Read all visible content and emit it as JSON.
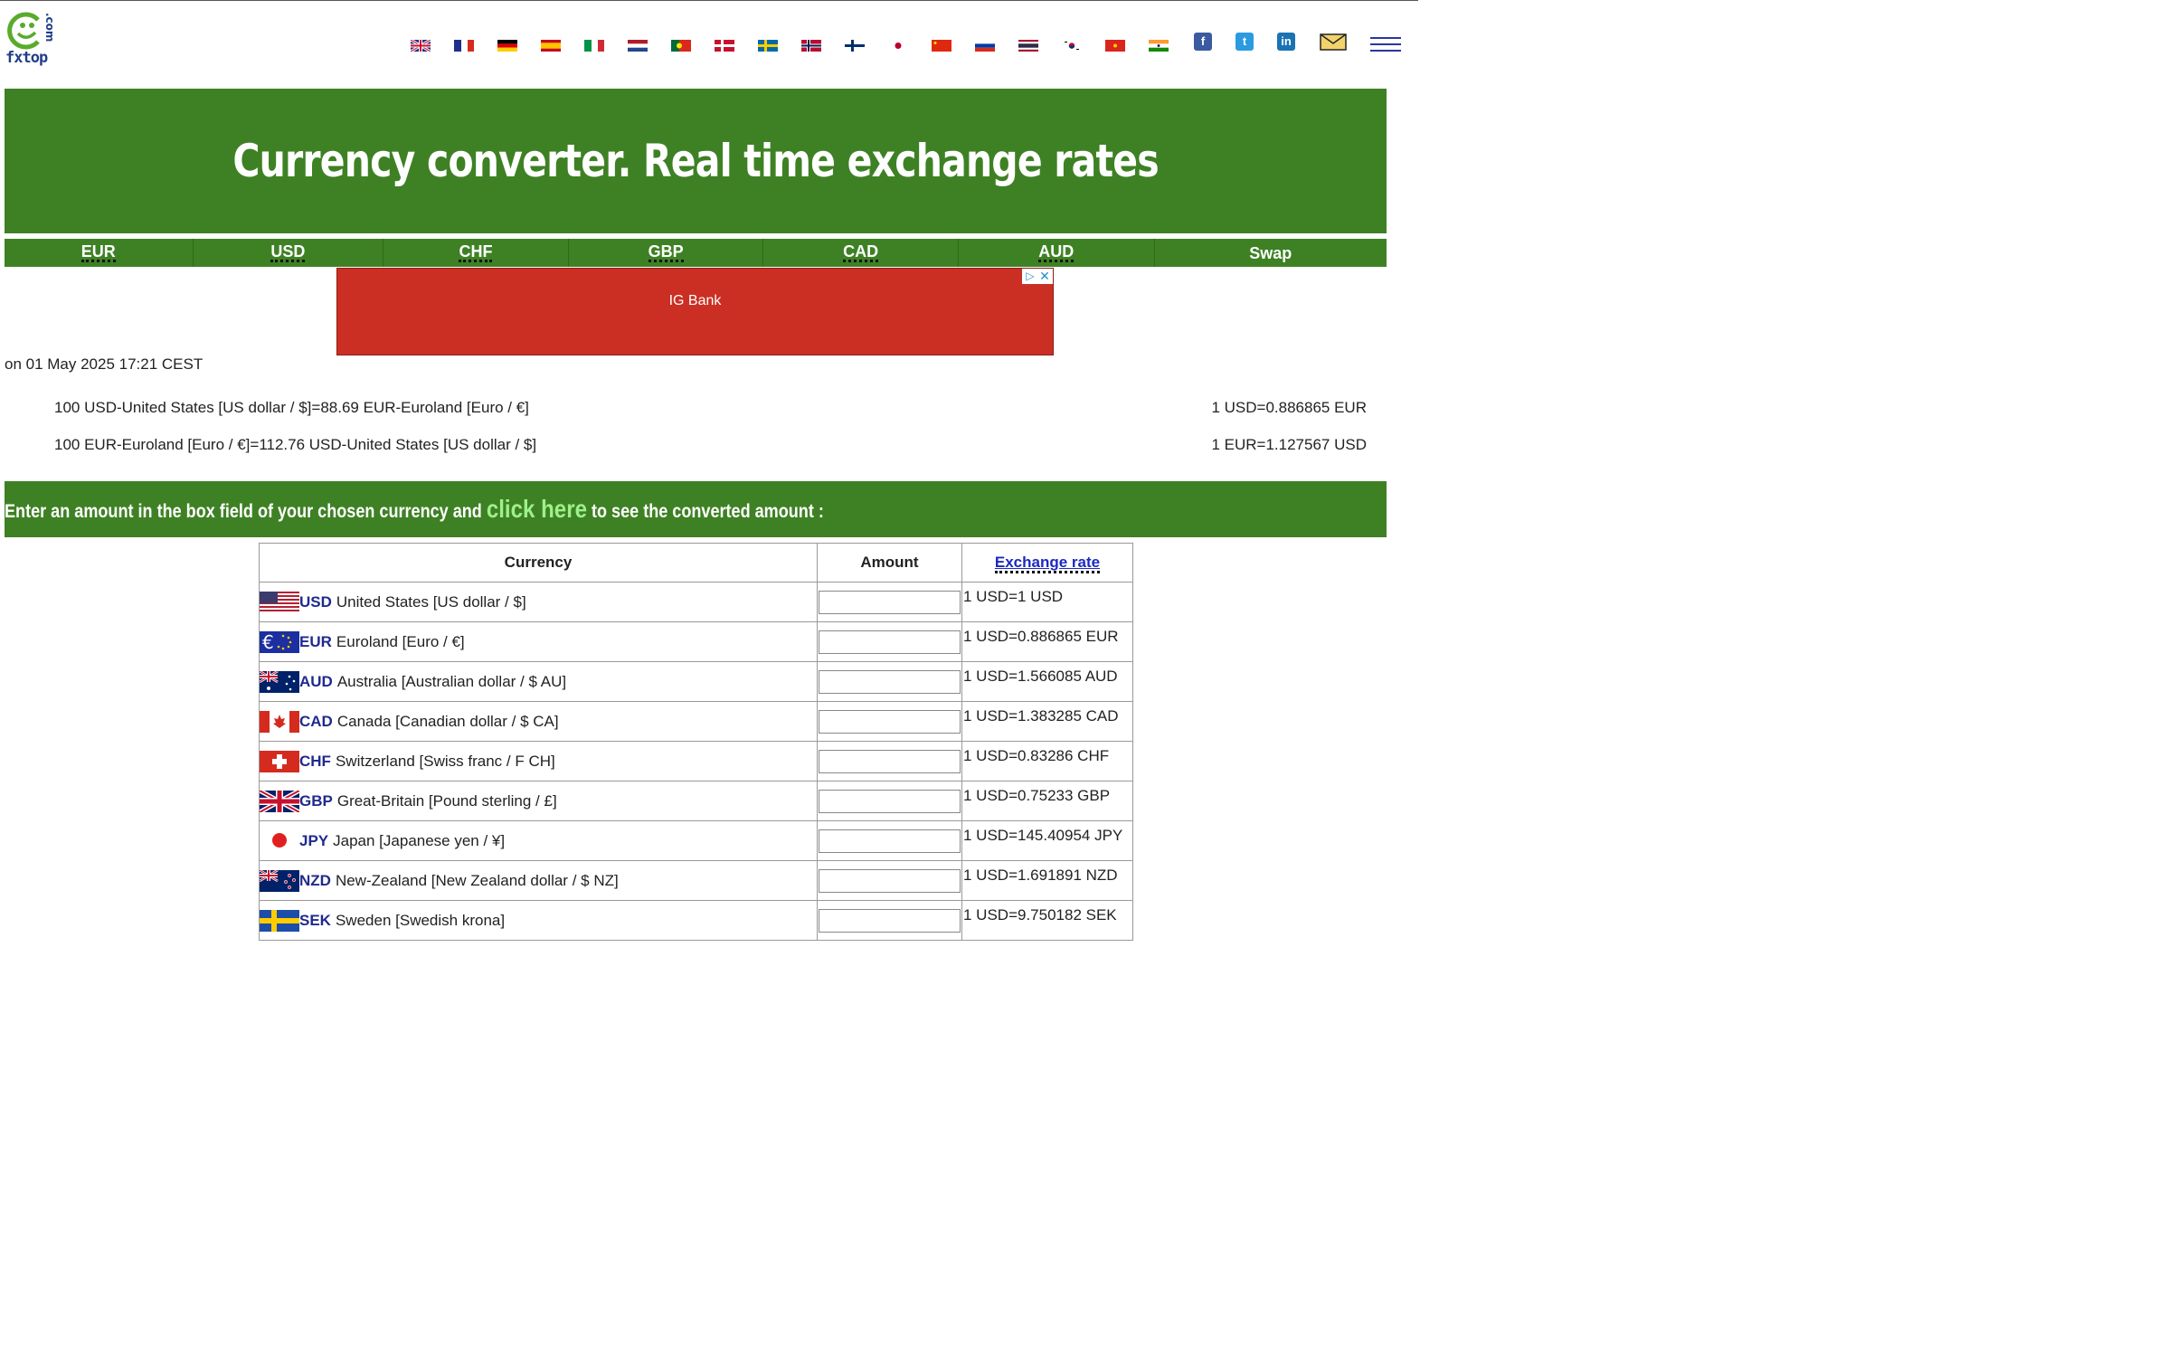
{
  "site": {
    "logo_text": "fxtop",
    "logo_suffix": ".com",
    "languages": [
      "English",
      "French",
      "German",
      "Spanish",
      "Italian",
      "Dutch",
      "Portuguese",
      "Danish",
      "Swedish",
      "Norwegian",
      "Finnish",
      "Japanese",
      "Chinese",
      "Russian",
      "Thai",
      "Korean",
      "Vietnamese",
      "Hindi"
    ],
    "social": [
      "facebook",
      "twitter",
      "linkedin"
    ],
    "accent_green": "#3e8124",
    "link_green": "#9ef08b"
  },
  "banner": {
    "title": "Currency converter. Real time exchange rates"
  },
  "currency_nav": [
    "EUR",
    "USD",
    "CHF",
    "GBP",
    "CAD",
    "AUD",
    "Swap"
  ],
  "ad": {
    "label": "IG Bank"
  },
  "timestamp": "on 01 May 2025 17:21 CEST",
  "rates": {
    "line1_left": "100 USD-United States [US dollar / $]=88.69 EUR-Euroland [Euro / €]",
    "line1_right": "1 USD=0.886865 EUR",
    "line2_left": "100 EUR-Euroland [Euro / €]=112.76 USD-United States [US dollar / $]",
    "line2_right": "1 EUR=1.127567 USD"
  },
  "prompt": {
    "before": "Enter an amount in the box field of your chosen currency and ",
    "link": "click here",
    "after": " to see the converted amount :"
  },
  "table": {
    "headers": {
      "currency": "Currency",
      "amount": "Amount",
      "rate": "Exchange rate"
    },
    "rows": [
      {
        "code": "USD",
        "name": "United States [US dollar / $]",
        "rate": "1 USD=1 USD",
        "flag": "us-flag"
      },
      {
        "code": "EUR",
        "name": "Euroland [Euro / €]",
        "rate": "1 USD=0.886865 EUR",
        "flag": "eu-flag"
      },
      {
        "code": "AUD",
        "name": "Australia [Australian dollar / $ AU]",
        "rate": "1 USD=1.566085 AUD",
        "flag": "au-flag"
      },
      {
        "code": "CAD",
        "name": "Canada [Canadian dollar / $ CA]",
        "rate": "1 USD=1.383285 CAD",
        "flag": "ca-flag"
      },
      {
        "code": "CHF",
        "name": "Switzerland [Swiss franc / F CH]",
        "rate": "1 USD=0.83286 CHF",
        "flag": "ch-flag"
      },
      {
        "code": "GBP",
        "name": "Great-Britain [Pound sterling / £]",
        "rate": "1 USD=0.75233 GBP",
        "flag": "gb-flag"
      },
      {
        "code": "JPY",
        "name": "Japan [Japanese yen / ¥]",
        "rate": "1 USD=145.40954 JPY",
        "flag": "jp-flag"
      },
      {
        "code": "NZD",
        "name": "New-Zealand [New Zealand dollar / $ NZ]",
        "rate": "1 USD=1.691891 NZD",
        "flag": "nz-flag"
      },
      {
        "code": "SEK",
        "name": "Sweden [Swedish krona]",
        "rate": "1 USD=9.750182 SEK",
        "flag": "se-flag"
      }
    ]
  }
}
